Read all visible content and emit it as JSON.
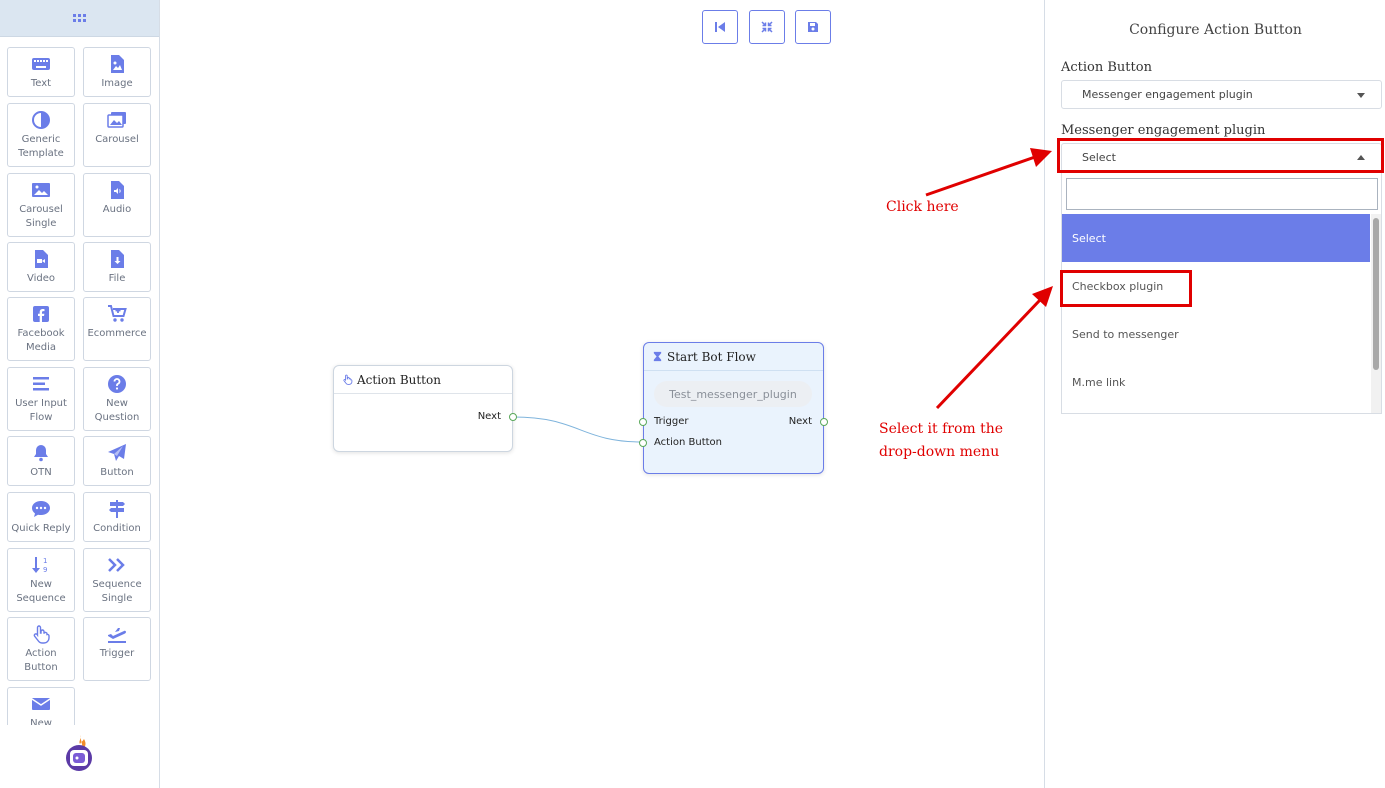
{
  "sidebar": {
    "tools": [
      {
        "label": "Text",
        "icon": "keyboard-icon"
      },
      {
        "label": "Image",
        "icon": "image-file-icon"
      },
      {
        "label": "Generic Template",
        "icon": "half-circle-icon"
      },
      {
        "label": "Carousel",
        "icon": "images-icon"
      },
      {
        "label": "Carousel Single",
        "icon": "image-icon"
      },
      {
        "label": "Audio",
        "icon": "audio-file-icon"
      },
      {
        "label": "Video",
        "icon": "video-file-icon"
      },
      {
        "label": "File",
        "icon": "download-file-icon"
      },
      {
        "label": "Facebook Media",
        "icon": "facebook-icon"
      },
      {
        "label": "Ecommerce",
        "icon": "cart-icon"
      },
      {
        "label": "User Input Flow",
        "icon": "lines-icon"
      },
      {
        "label": "New Question",
        "icon": "question-icon"
      },
      {
        "label": "OTN",
        "icon": "bell-icon"
      },
      {
        "label": "Button",
        "icon": "paper-plane-icon"
      },
      {
        "label": "Quick Reply",
        "icon": "chat-bubble-icon"
      },
      {
        "label": "Condition",
        "icon": "signpost-icon"
      },
      {
        "label": "New Sequence",
        "icon": "sort-number-icon"
      },
      {
        "label": "Sequence Single",
        "icon": "double-chevron-icon"
      },
      {
        "label": "Action Button",
        "icon": "hand-pointer-icon"
      },
      {
        "label": "Trigger",
        "icon": "plane-departure-icon"
      },
      {
        "label": "New",
        "icon": "envelope-icon"
      }
    ]
  },
  "canvas": {
    "toolbar": [
      "skip-back-icon",
      "compress-icon",
      "save-icon"
    ],
    "action_node": {
      "title": "Action Button",
      "next_label": "Next"
    },
    "flow_node": {
      "title": "Start Bot Flow",
      "pill": "Test_messenger_plugin",
      "trigger_label": "Trigger",
      "action_label": "Action Button",
      "next_label": "Next"
    },
    "annotations": {
      "click_here": "Click here",
      "select_line1": "Select it from the",
      "select_line2": "drop-down menu"
    }
  },
  "panel": {
    "title": "Configure Action Button",
    "action_button_label": "Action Button",
    "action_button_value": "Messenger engagement plugin",
    "plugin_label": "Messenger engagement plugin",
    "plugin_value": "Select",
    "options": [
      "Select",
      "Checkbox plugin",
      "Send to messenger",
      "M.me link"
    ]
  },
  "colors": {
    "accent": "#6b7de8",
    "annotation": "#e00000",
    "flow_node_bg": "#eaf3fd"
  }
}
